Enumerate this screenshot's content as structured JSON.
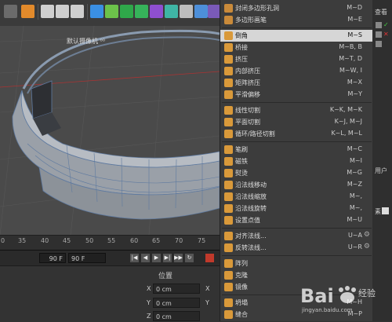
{
  "menu": {
    "items": [
      {
        "label": "封闭多边形孔洞",
        "shortcut": "M~D",
        "icon": "close-hole-icon",
        "color": "#c98a3a"
      },
      {
        "label": "多边形画笔",
        "shortcut": "M~E",
        "icon": "polygon-pen-icon",
        "color": "#c98a3a"
      },
      {
        "label": "倒角",
        "shortcut": "M~S",
        "icon": "bevel-icon",
        "color": "#d9993a",
        "highlight": true
      },
      {
        "label": "桥接",
        "shortcut": "M~B, B",
        "icon": "bridge-icon",
        "color": "#d9993a"
      },
      {
        "label": "挤压",
        "shortcut": "M~T, D",
        "icon": "extrude-icon",
        "color": "#d9993a"
      },
      {
        "label": "内部挤压",
        "shortcut": "M~W, I",
        "icon": "extrude-inner-icon",
        "color": "#d9993a"
      },
      {
        "label": "矩阵挤压",
        "shortcut": "M~X",
        "icon": "matrix-extrude-icon",
        "color": "#d9993a"
      },
      {
        "label": "平滑偏移",
        "shortcut": "M~Y",
        "icon": "smooth-shift-icon",
        "color": "#d9993a"
      },
      {
        "label": "线性切割",
        "shortcut": "K~K, M~K",
        "icon": "line-cut-icon",
        "color": "#d9993a"
      },
      {
        "label": "平面切割",
        "shortcut": "K~J, M~J",
        "icon": "plane-cut-icon",
        "color": "#d9993a"
      },
      {
        "label": "循环/路径切割",
        "shortcut": "K~L, M~L",
        "icon": "loop-cut-icon",
        "color": "#d9993a"
      },
      {
        "label": "笔刷",
        "shortcut": "M~C",
        "icon": "brush-icon",
        "color": "#d9993a"
      },
      {
        "label": "磁铁",
        "shortcut": "M~I",
        "icon": "magnet-icon",
        "color": "#d9993a"
      },
      {
        "label": "熨烫",
        "shortcut": "M~G",
        "icon": "iron-icon",
        "color": "#d9993a"
      },
      {
        "label": "沿法线移动",
        "shortcut": "M~Z",
        "icon": "normal-move-icon",
        "color": "#d9993a"
      },
      {
        "label": "沿法线缩放",
        "shortcut": "M~,",
        "icon": "normal-scale-icon",
        "color": "#d9993a"
      },
      {
        "label": "沿法线旋转",
        "shortcut": "M~,",
        "icon": "normal-rotate-icon",
        "color": "#d9993a"
      },
      {
        "label": "设置点值",
        "shortcut": "M~U",
        "icon": "set-point-icon",
        "color": "#d9993a"
      },
      {
        "label": "对齐法线...",
        "shortcut": "U~A",
        "icon": "align-normals-icon",
        "color": "#d9993a",
        "gear": true
      },
      {
        "label": "反转法线...",
        "shortcut": "U~R",
        "icon": "reverse-normals-icon",
        "color": "#d9993a",
        "gear": true
      },
      {
        "label": "阵列",
        "shortcut": "",
        "icon": "array-icon",
        "color": "#d9993a"
      },
      {
        "label": "克隆",
        "shortcut": "",
        "icon": "clone-icon",
        "color": "#d9993a"
      },
      {
        "label": "镜像",
        "shortcut": "",
        "icon": "mirror-icon",
        "color": "#d9993a"
      },
      {
        "label": "坍塌",
        "shortcut": "M~H",
        "icon": "collapse-icon",
        "color": "#d9993a"
      },
      {
        "label": "缝合",
        "shortcut": "M~P",
        "icon": "stitch-icon",
        "color": "#d9993a"
      }
    ]
  },
  "viewport": {
    "camera_label": "默认摄像机 ⁰⁰"
  },
  "ruler": {
    "ticks": [
      "0",
      "35",
      "40",
      "45",
      "50",
      "55",
      "60",
      "65",
      "70",
      "75"
    ]
  },
  "timeline": {
    "frame_field_1": "90 F",
    "frame_field_2": "90 F"
  },
  "attributes": {
    "section_title": "位置",
    "x_label": "X",
    "x_value": "0 cm",
    "x_label_2": "X",
    "y_label": "Y",
    "y_value": "0 cm",
    "y_label_2": "Y",
    "z_label": "Z",
    "z_value": "0 cm"
  },
  "right_panel": {
    "header": "查看",
    "user_label": "用户",
    "side_label": "素"
  },
  "watermark": {
    "text": "Bai",
    "suffix": "经验",
    "sub": "jingyan.baidu.com"
  }
}
